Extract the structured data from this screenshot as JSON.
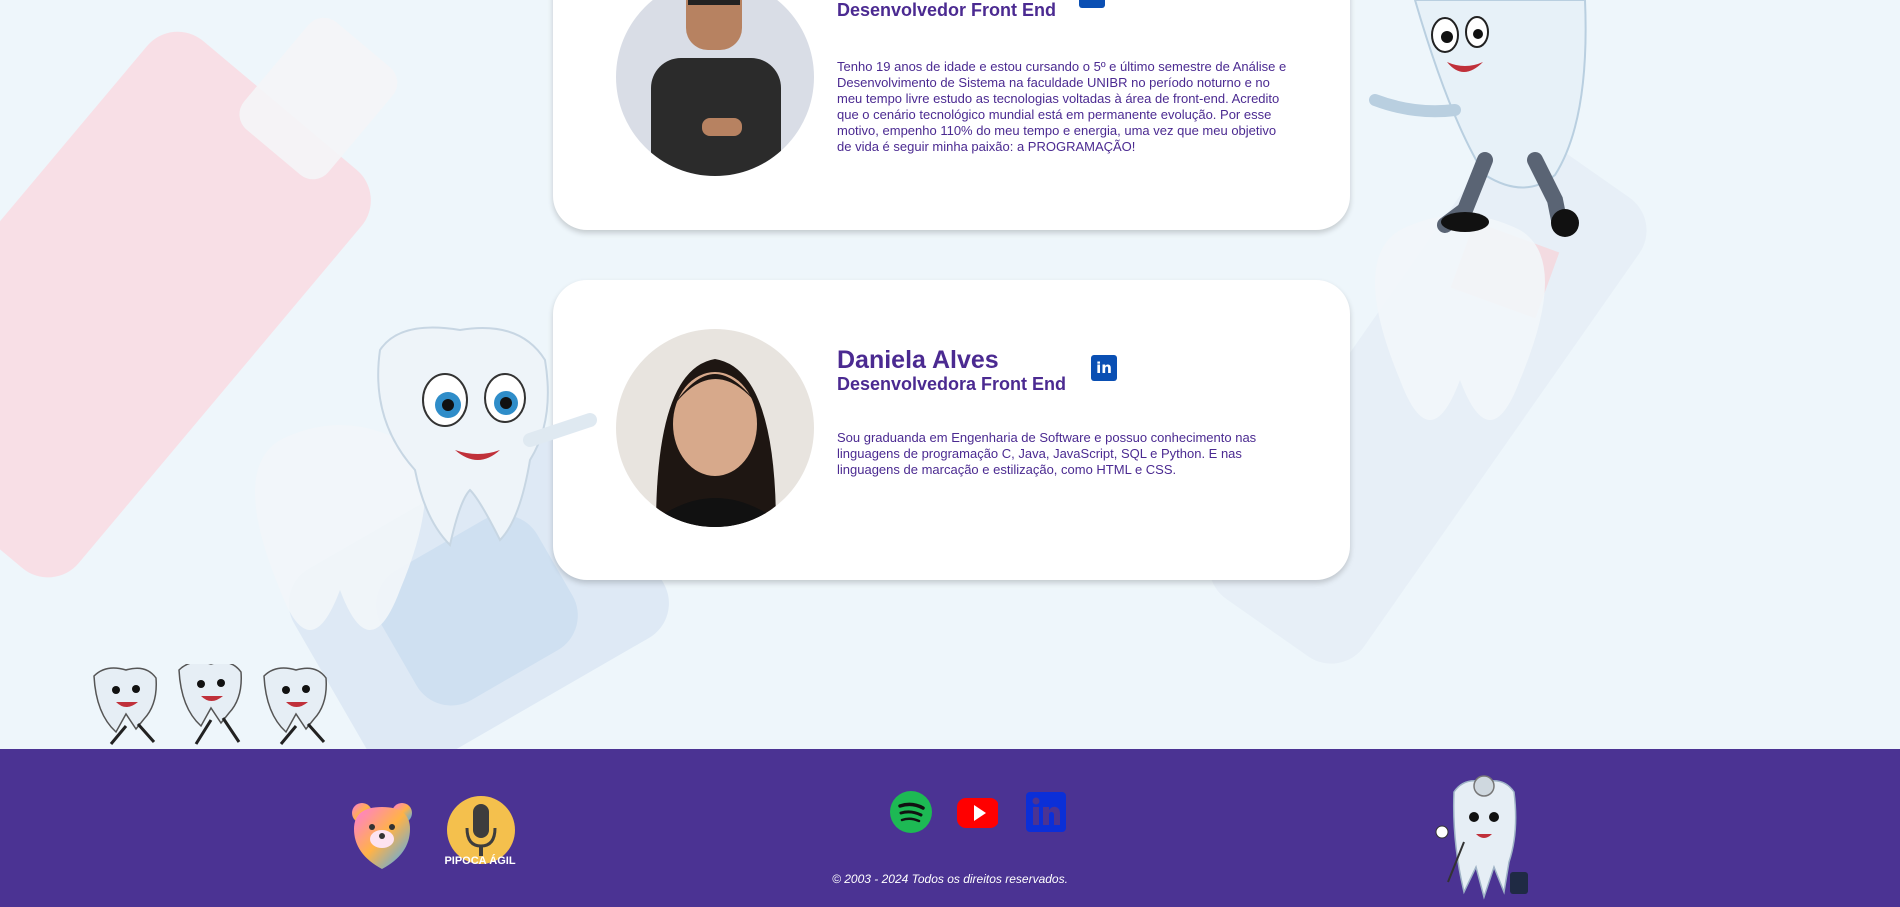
{
  "team": [
    {
      "name": "",
      "role": "Desenvolvedor Front End",
      "bio": "Tenho 19 anos de idade e estou cursando o 5º e último semestre de Análise e Desenvolvimento de Sistema na faculdade UNIBR no período noturno e no meu tempo livre estudo as tecnologias voltadas à área de front-end. Acredito que o cenário tecnológico mundial está em permanente evolução. Por esse motivo, empenho 110% do meu tempo e energia, uma vez que meu objetivo de vida é seguir minha paixão: a PROGRAMAÇÃO!",
      "linkedin_icon": "linkedin-icon"
    },
    {
      "name": "Daniela Alves",
      "role": "Desenvolvedora Front End",
      "bio": "Sou graduanda em Engenharia de Software e possuo conhecimento nas linguagens de programação C, Java, JavaScript, SQL e Python. E nas linguagens de marcação e estilização, como HTML e CSS.",
      "linkedin_icon": "linkedin-icon"
    }
  ],
  "footer": {
    "copyright": "© 2003 - 2024 Todos os direitos reservados.",
    "podcast_logo_text": "PIPOCA ÁGIL",
    "social": [
      "spotify-icon",
      "youtube-icon",
      "linkedin-icon"
    ]
  },
  "colors": {
    "brand_purple": "#4b3393",
    "text_purple": "#4b2a91",
    "linkedin_blue": "#0a4fb3",
    "spotify_green": "#1db954",
    "youtube_red": "#ff0000",
    "background": "#eef6fb"
  }
}
